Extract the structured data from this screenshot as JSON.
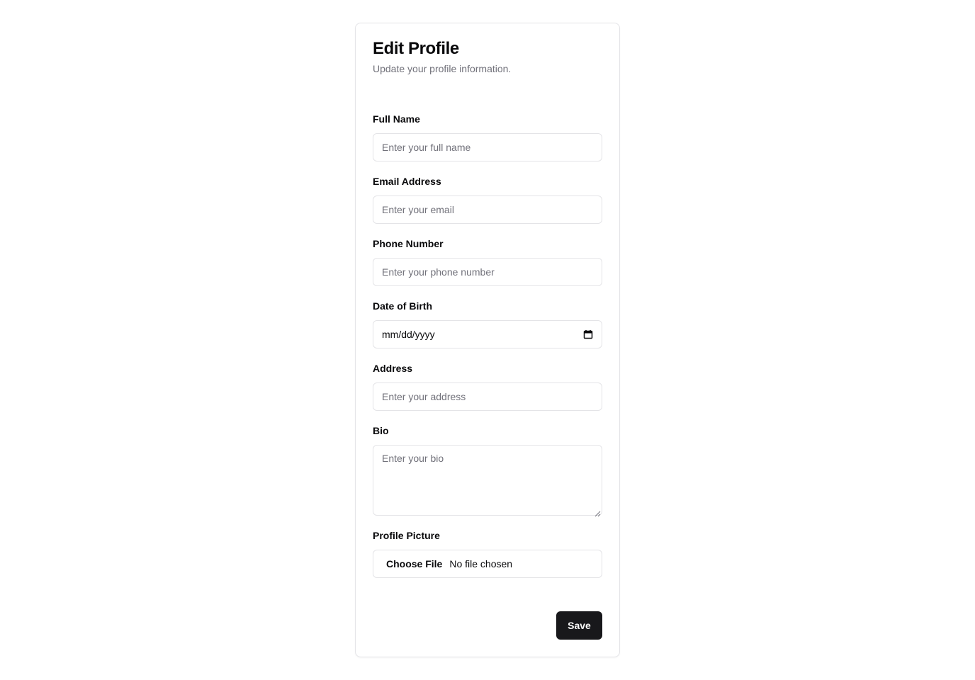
{
  "header": {
    "title": "Edit Profile",
    "subtitle": "Update your profile information."
  },
  "fields": {
    "full_name": {
      "label": "Full Name",
      "placeholder": "Enter your full name",
      "value": ""
    },
    "email": {
      "label": "Email Address",
      "placeholder": "Enter your email",
      "value": ""
    },
    "phone": {
      "label": "Phone Number",
      "placeholder": "Enter your phone number",
      "value": ""
    },
    "dob": {
      "label": "Date of Birth",
      "display": "mm/dd/yyyy",
      "icon": "calendar-icon"
    },
    "address": {
      "label": "Address",
      "placeholder": "Enter your address",
      "value": ""
    },
    "bio": {
      "label": "Bio",
      "placeholder": "Enter your bio",
      "value": ""
    },
    "picture": {
      "label": "Profile Picture",
      "button_label": "Choose File",
      "status": "No file chosen"
    }
  },
  "actions": {
    "save_label": "Save"
  },
  "colors": {
    "primary": "#18181b",
    "border": "#e4e4e7",
    "muted_text": "#71717a"
  }
}
